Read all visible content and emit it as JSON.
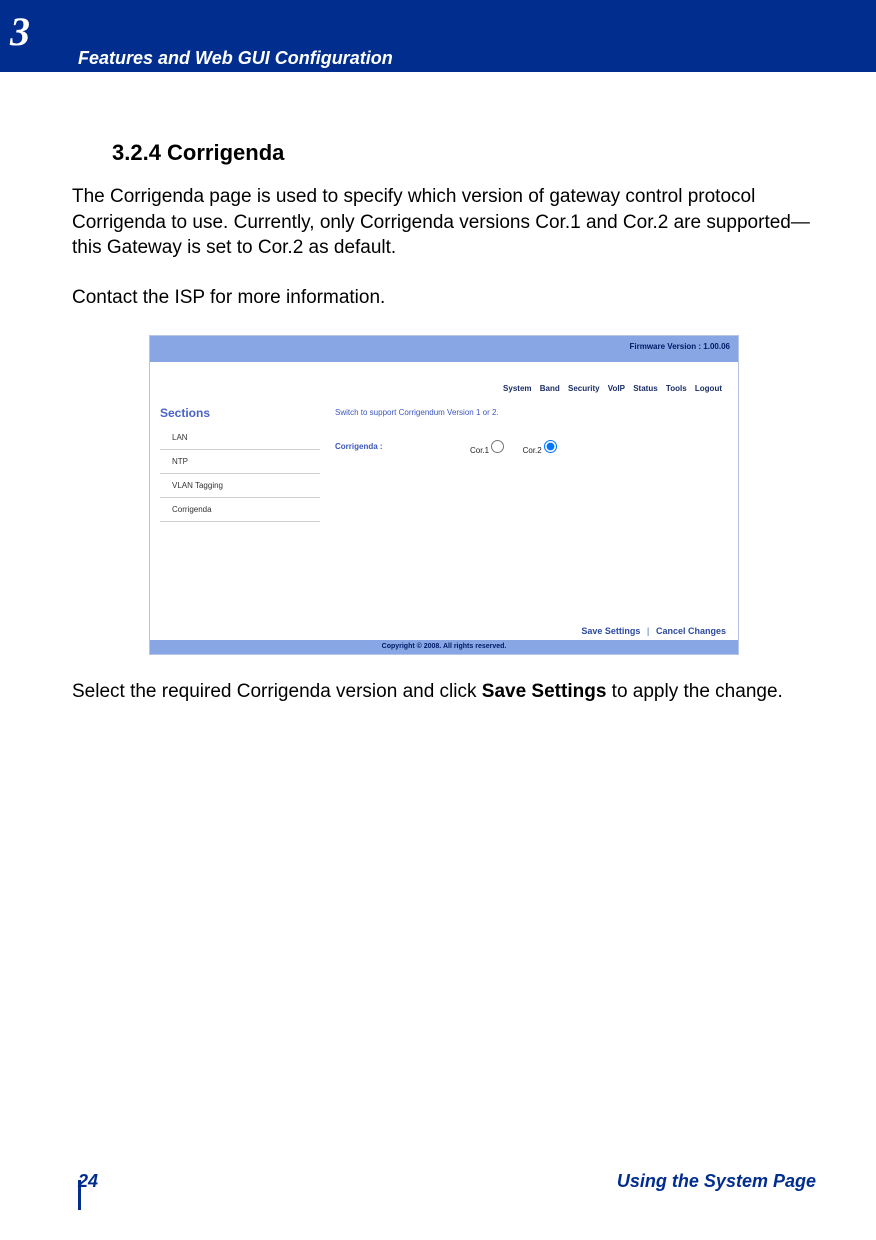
{
  "chapter": {
    "number": "3",
    "title": "Features and Web GUI Configuration"
  },
  "heading": "3.2.4 Corrigenda",
  "para1": "The Corrigenda page is used to specify which version of gateway control proto­col Corrigenda to use. Currently, only Corrigenda versions Cor.1 and Cor.2 are supported—this Gateway is set to Cor.2 as default.",
  "para2": "Contact the ISP for more information.",
  "para3_pre": "Select the required Corrigenda version and click ",
  "para3_bold": "Save Settings",
  "para3_post": " to apply the change.",
  "screenshot": {
    "firmware": "Firmware Version : 1.00.06",
    "nav": [
      "System",
      "Band",
      "Security",
      "VoIP",
      "Status",
      "Tools",
      "Logout"
    ],
    "sections_label": "Sections",
    "sections": [
      "LAN",
      "NTP",
      "VLAN Tagging",
      "Corrigenda"
    ],
    "hint": "Switch to support Corrigendum Version 1 or 2.",
    "form_label": "Corrigenda :",
    "options": {
      "cor1": "Cor.1",
      "cor2": "Cor.2"
    },
    "save": "Save Settings",
    "cancel": "Cancel Changes",
    "copyright": "Copyright © 2008.  All rights reserved."
  },
  "footer": {
    "page": "24",
    "section": "Using the System Page"
  }
}
